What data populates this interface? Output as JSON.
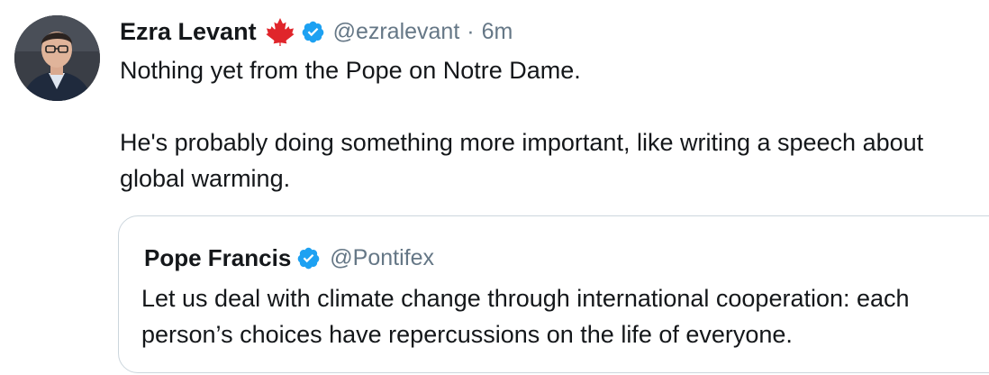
{
  "tweet": {
    "author": {
      "display_name": "Ezra Levant",
      "flag_emoji": "🍁",
      "handle": "@ezralevant",
      "separator": "·",
      "time": "6m"
    },
    "text": {
      "line1": "Nothing yet from the Pope on Notre Dame.",
      "line2": "He's probably doing something more important, like writing a speech about global warming."
    },
    "quoted": {
      "display_name": "Pope Francis",
      "handle": "@Pontifex",
      "text": "Let us deal with climate change through international cooperation: each person’s choices have repercussions on the life of everyone."
    }
  },
  "colors": {
    "verified_blue": "#1da1f2",
    "maple_red": "#e0252b",
    "secondary_text": "#657786",
    "border": "#ccd6dd"
  },
  "icons": {
    "flag": "maple-leaf-icon",
    "verified": "verified-badge-icon"
  }
}
